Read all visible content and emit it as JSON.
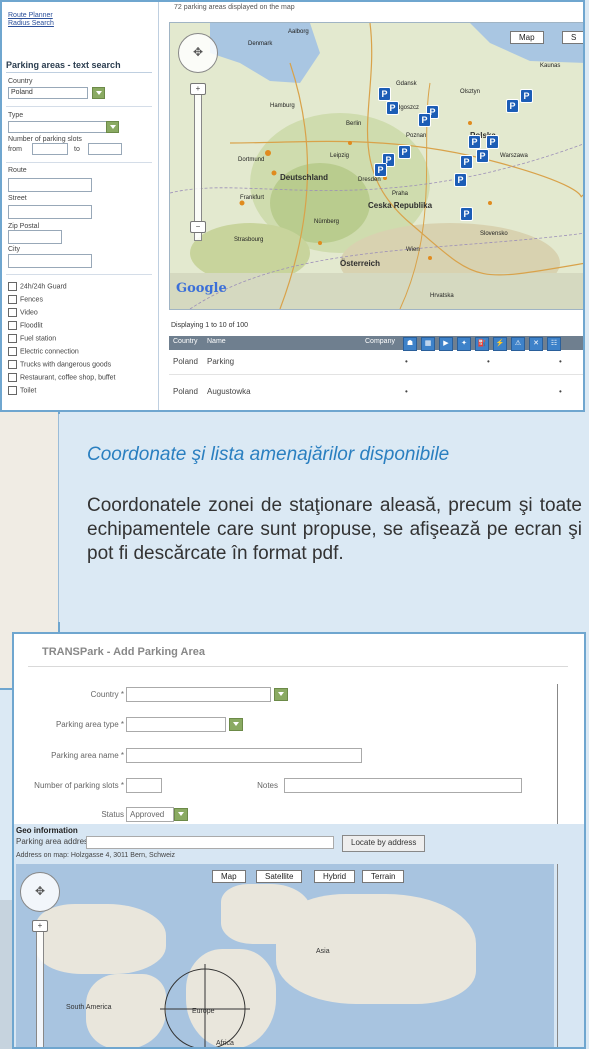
{
  "search_screen": {
    "sidebar_links": [
      "Route Planner",
      "Radius Search"
    ],
    "map_notice": "72 parking areas displayed on the map",
    "panel_title": "Parking areas - text search",
    "fields": {
      "country_label": "Country",
      "country_value": "Poland",
      "type_label": "Type",
      "slots_label": "Number of parking slots",
      "from_label": "from",
      "to_label": "to",
      "route_label": "Route",
      "street_label": "Street",
      "zip_label": "Zip Postal",
      "city_label": "City"
    },
    "checkbox_options": [
      "24h/24h Guard",
      "Fences",
      "Video",
      "Floodlit",
      "Fuel station",
      "Electric connection",
      "Trucks with dangerous goods",
      "Restaurant, coffee shop, buffet",
      "Toilet"
    ],
    "map_buttons": [
      "Map",
      "S"
    ],
    "map_cities": [
      {
        "name": "Denmark",
        "big": false
      },
      {
        "name": "Aalborg",
        "big": false
      },
      {
        "name": "Kaunas",
        "big": false
      },
      {
        "name": "Gdansk",
        "big": false
      },
      {
        "name": "Bydgoszcz",
        "big": false
      },
      {
        "name": "Olsztyn",
        "big": false
      },
      {
        "name": "Polska",
        "big": true
      },
      {
        "name": "Hamburg",
        "big": false
      },
      {
        "name": "Berlin",
        "big": false
      },
      {
        "name": "Poznan",
        "big": false
      },
      {
        "name": "Warszawa",
        "big": false
      },
      {
        "name": "Dortmund",
        "big": false
      },
      {
        "name": "Leipzig",
        "big": false
      },
      {
        "name": "Deutschland",
        "big": true
      },
      {
        "name": "Dresden",
        "big": false
      },
      {
        "name": "Frankfurt",
        "big": false
      },
      {
        "name": "Ceska Republika",
        "big": true
      },
      {
        "name": "Praha",
        "big": false
      },
      {
        "name": "Nürnberg",
        "big": false
      },
      {
        "name": "Strasbourg",
        "big": false
      },
      {
        "name": "Wien",
        "big": false
      },
      {
        "name": "Österreich",
        "big": true
      },
      {
        "name": "Slovensko",
        "big": false
      },
      {
        "name": "Hrvatska",
        "big": false
      }
    ],
    "google_logo": "Google",
    "results": {
      "displaying": "Displaying 1 to 10 of 100",
      "columns": [
        "Country",
        "Name",
        "Company"
      ],
      "rows": [
        {
          "country": "Poland",
          "name": "Parking"
        },
        {
          "country": "Poland",
          "name": "Augustowka"
        }
      ]
    }
  },
  "caption": {
    "title": "Coordonate şi lista amenajărilor disponibile",
    "body": "Coordonatele zonei de staţionare aleasă, precum şi toate echipamentele care sunt propuse, se afişează pe ecran şi pot fi descărcate în format pdf."
  },
  "add_screen": {
    "title": "TRANSPark - Add Parking Area",
    "fields": {
      "country_label": "Country *",
      "type_label": "Parking area type *",
      "name_label": "Parking area name *",
      "slots_label": "Number of parking slots *",
      "notes_label": "Notes",
      "status_label": "Status",
      "status_value": "Approved"
    },
    "geo": {
      "title": "Geo information",
      "address_label": "Parking area address:",
      "locate_button": "Locate by address",
      "address_note": "Address on map: Holzgasse 4, 3011 Bern, Schweiz",
      "map_buttons": [
        "Map",
        "Satellite",
        "Hybrid",
        "Terrain"
      ],
      "regions": [
        "Europe",
        "Asia",
        "South America",
        "Africa"
      ]
    }
  },
  "colors": {
    "accent": "#2a7fc0",
    "frame": "#6fa6cf",
    "marker": "#1c5db6",
    "dropdown": "#8aaa62"
  }
}
